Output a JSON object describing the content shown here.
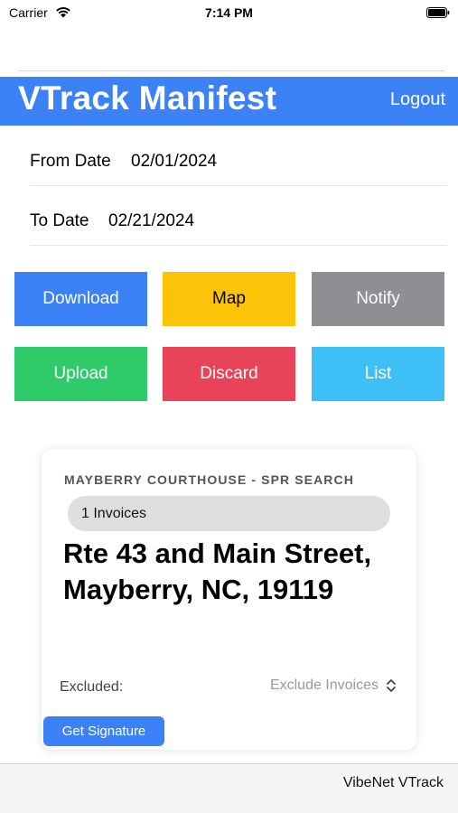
{
  "status_bar": {
    "carrier": "Carrier",
    "time": "7:14 PM"
  },
  "header": {
    "title": "VTrack Manifest",
    "logout_label": "Logout",
    "color": "#3c82f6"
  },
  "dates": {
    "from_label": "From Date",
    "from_value": "02/01/2024",
    "to_label": "To Date",
    "to_value": "02/21/2024"
  },
  "actions": {
    "download": "Download",
    "map": "Map",
    "notify": "Notify",
    "upload": "Upload",
    "discard": "Discard",
    "list": "List"
  },
  "card": {
    "subtitle": "MAYBERRY COURTHOUSE - SPR SEARCH",
    "invoice_count": "1 Invoices",
    "address": "Rte 43 and Main Street, Mayberry, NC, 19119",
    "excluded_label": "Excluded:",
    "exclude_placeholder": "Exclude Invoices",
    "signature_button": "Get Signature"
  },
  "footer": {
    "text": "VibeNet VTrack"
  }
}
